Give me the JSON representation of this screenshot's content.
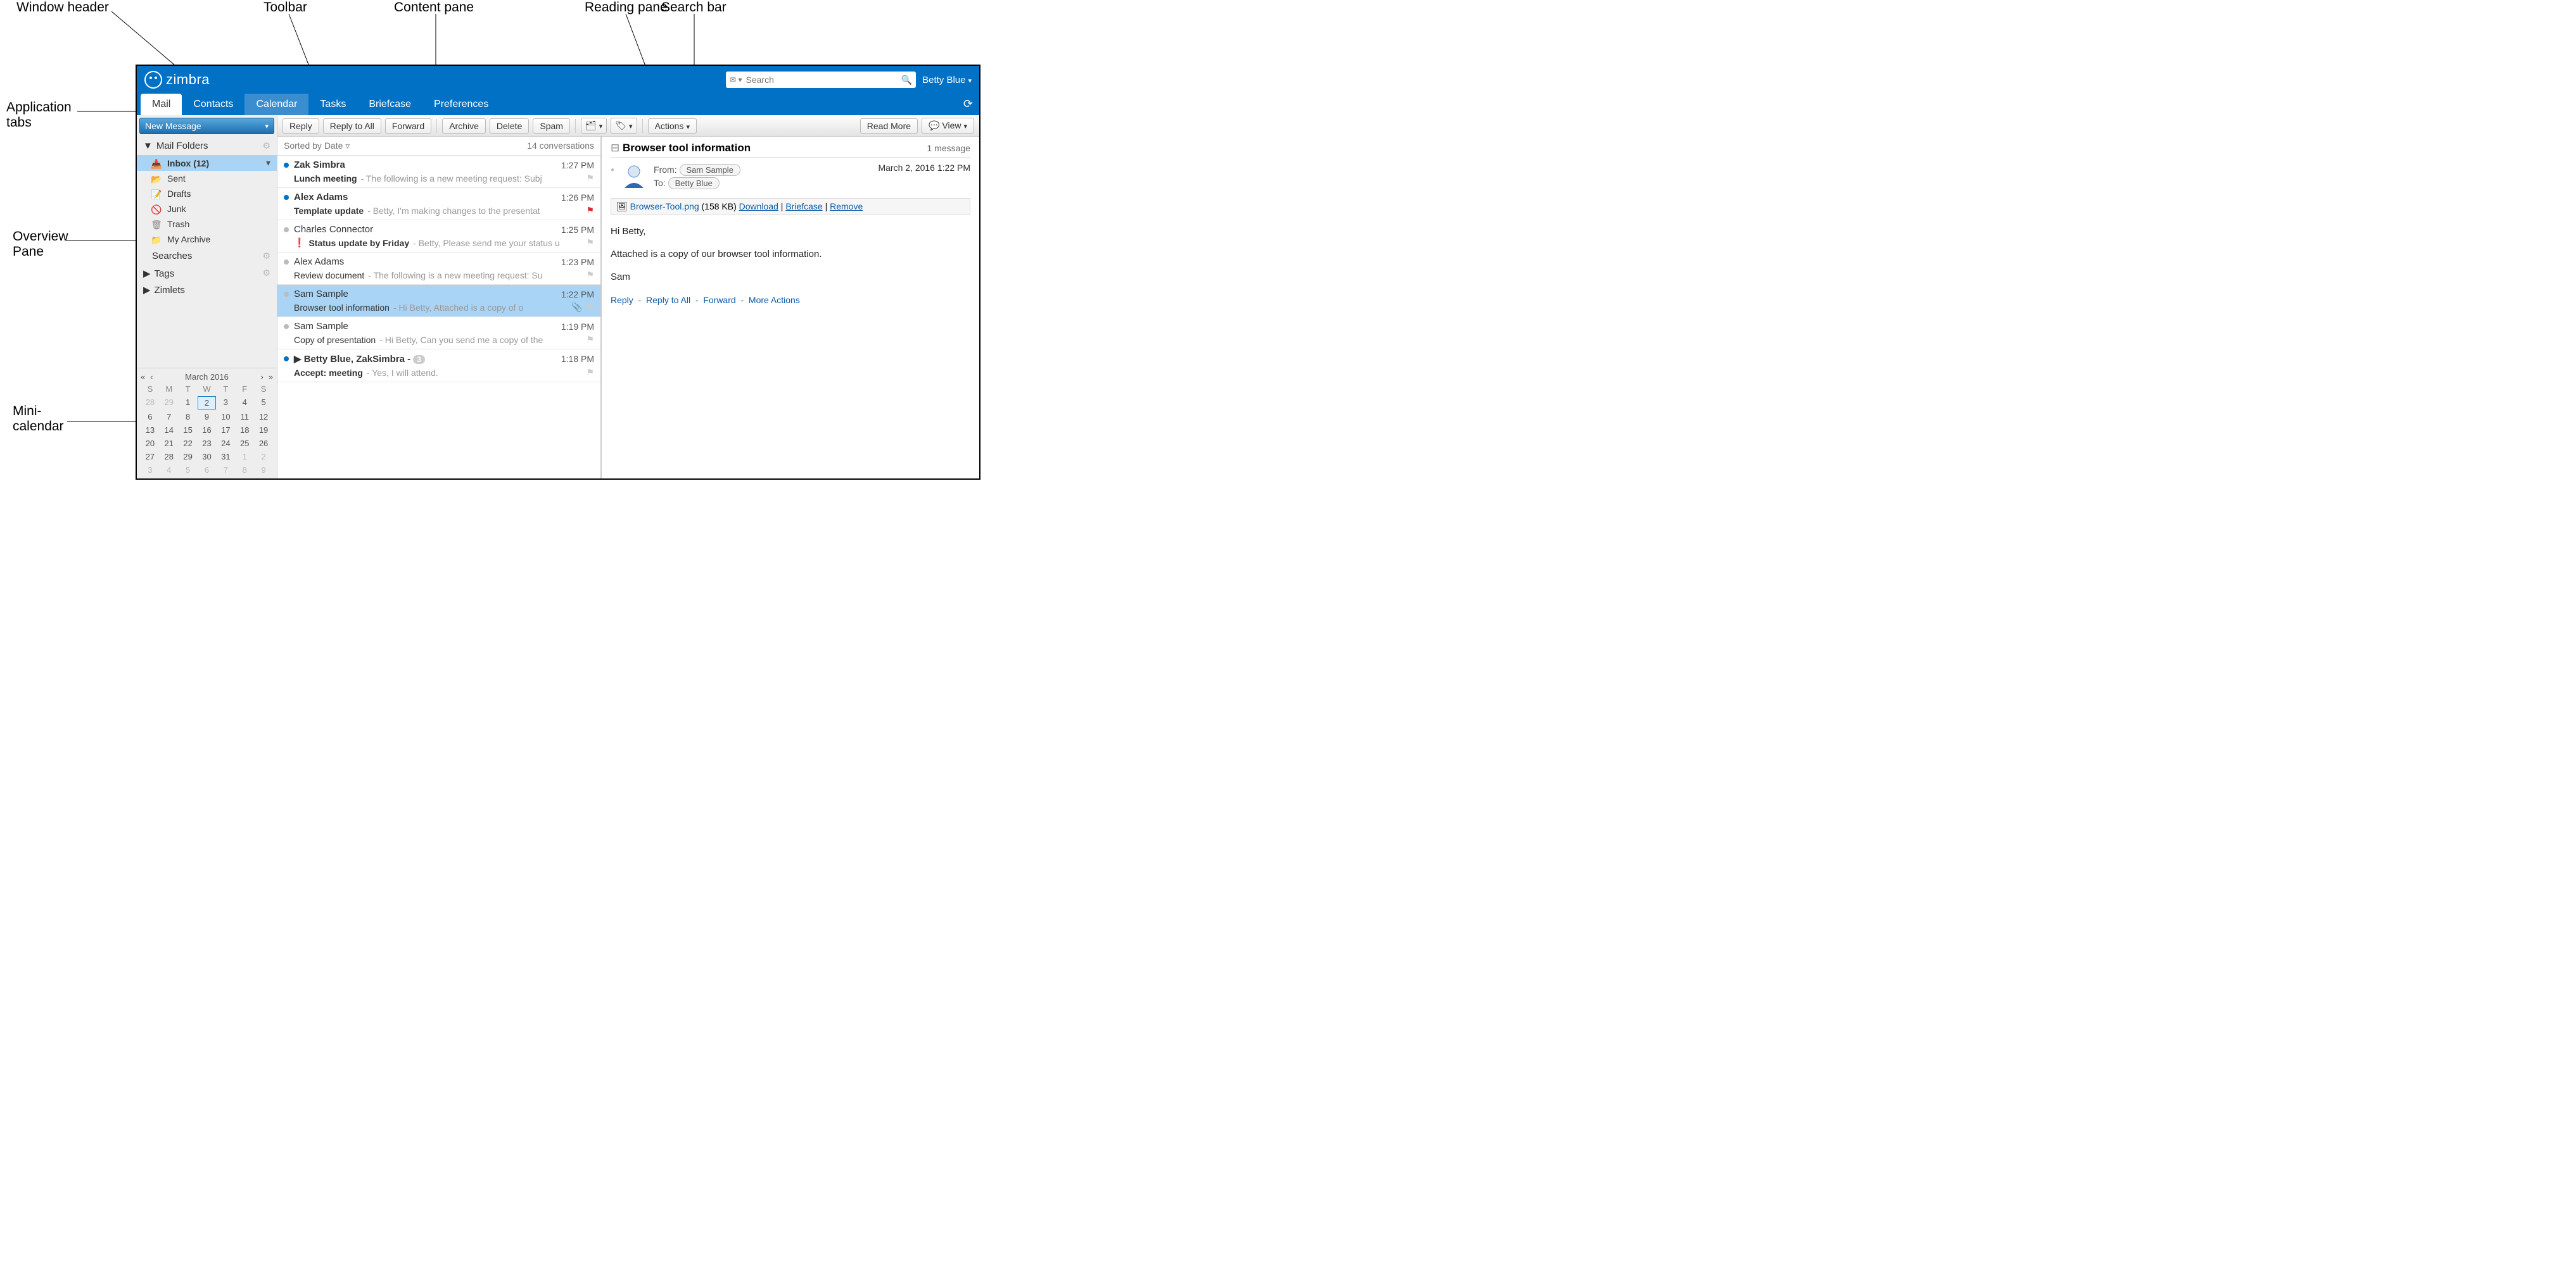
{
  "callouts": {
    "window_header": "Window header",
    "toolbar": "Toolbar",
    "content_pane": "Content pane",
    "reading_pane": "Reading pane",
    "search_bar": "Search bar",
    "application_tabs": "Application tabs",
    "overview_pane": "Overview Pane",
    "mini_calendar": "Mini-calendar"
  },
  "header": {
    "brand": "zimbra",
    "search_placeholder": "Search",
    "user": "Betty Blue"
  },
  "tabs": [
    "Mail",
    "Contacts",
    "Calendar",
    "Tasks",
    "Briefcase",
    "Preferences"
  ],
  "sidebar": {
    "new_message": "New Message",
    "folders_label": "Mail Folders",
    "folders": [
      {
        "name": "Inbox (12)",
        "icon": "📥",
        "selected": true
      },
      {
        "name": "Sent",
        "icon": "📂"
      },
      {
        "name": "Drafts",
        "icon": "📝"
      },
      {
        "name": "Junk",
        "icon": "🚫"
      },
      {
        "name": "Trash",
        "icon": "🗑"
      },
      {
        "name": "My Archive",
        "icon": "📁"
      }
    ],
    "searches_label": "Searches",
    "tags_label": "Tags",
    "zimlets_label": "Zimlets"
  },
  "calendar": {
    "title": "March 2016",
    "dow": [
      "S",
      "M",
      "T",
      "W",
      "T",
      "F",
      "S"
    ],
    "weeks": [
      [
        "28",
        "29",
        "1",
        "2",
        "3",
        "4",
        "5"
      ],
      [
        "6",
        "7",
        "8",
        "9",
        "10",
        "11",
        "12"
      ],
      [
        "13",
        "14",
        "15",
        "16",
        "17",
        "18",
        "19"
      ],
      [
        "20",
        "21",
        "22",
        "23",
        "24",
        "25",
        "26"
      ],
      [
        "27",
        "28",
        "29",
        "30",
        "31",
        "1",
        "2"
      ],
      [
        "3",
        "4",
        "5",
        "6",
        "7",
        "8",
        "9"
      ]
    ],
    "today_row": 0,
    "today_col": 3,
    "muted_leading": 2,
    "muted_trailing_start_row": 4,
    "muted_trailing_start_col": 5
  },
  "toolbar": {
    "reply": "Reply",
    "reply_all": "Reply to All",
    "forward": "Forward",
    "archive": "Archive",
    "delete": "Delete",
    "spam": "Spam",
    "actions": "Actions",
    "read_more": "Read More",
    "view": "View"
  },
  "list": {
    "sort": "Sorted by Date",
    "count": "14 conversations",
    "items": [
      {
        "from": "Zak Simbra",
        "time": "1:27 PM",
        "unread": true,
        "subject": "Lunch meeting",
        "preview": "The following is a new meeting request: Subj",
        "flag": "gray"
      },
      {
        "from": "Alex Adams",
        "time": "1:26 PM",
        "unread": true,
        "subject": "Template update",
        "preview": "Betty, I'm making changes to the presentat",
        "flag": "red"
      },
      {
        "from": "Charles Connector",
        "time": "1:25 PM",
        "unread": false,
        "subject": "Status update by Friday",
        "preview": "Betty, Please send me your status u",
        "flag": "gray",
        "priority": true,
        "boldsub": true
      },
      {
        "from": "Alex Adams",
        "time": "1:23 PM",
        "unread": false,
        "subject": "Review document",
        "preview": "The following is a new meeting request: Su",
        "flag": "gray"
      },
      {
        "from": "Sam Sample",
        "time": "1:22 PM",
        "unread": false,
        "subject": "Browser tool information",
        "preview": "Hi Betty, Attached is a copy of o",
        "flag": "gray",
        "attach": true,
        "selected": true
      },
      {
        "from": "Sam Sample",
        "time": "1:19 PM",
        "unread": false,
        "subject": "Copy of presentation",
        "preview": "Hi Betty, Can you send me a copy of the",
        "flag": "gray"
      },
      {
        "from": "Betty Blue, ZakSimbra",
        "time": "1:18 PM",
        "unread": true,
        "subject": "Accept: meeting",
        "preview": "Yes, I will attend.",
        "flag": "gray",
        "thread": "3",
        "boldsub": true
      }
    ]
  },
  "reading": {
    "title": "Browser tool information",
    "count": "1 message",
    "from_label": "From:",
    "from": "Sam Sample",
    "to_label": "To:",
    "to": "Betty Blue",
    "date": "March 2, 2016 1:22 PM",
    "attach_name": "Browser-Tool.png",
    "attach_size": "(158 KB)",
    "download": "Download",
    "briefcase": "Briefcase",
    "remove": "Remove",
    "body": [
      "Hi Betty,",
      "Attached is a copy of our browser tool information.",
      "Sam"
    ],
    "actions": [
      "Reply",
      "Reply to All",
      "Forward",
      "More Actions"
    ]
  }
}
